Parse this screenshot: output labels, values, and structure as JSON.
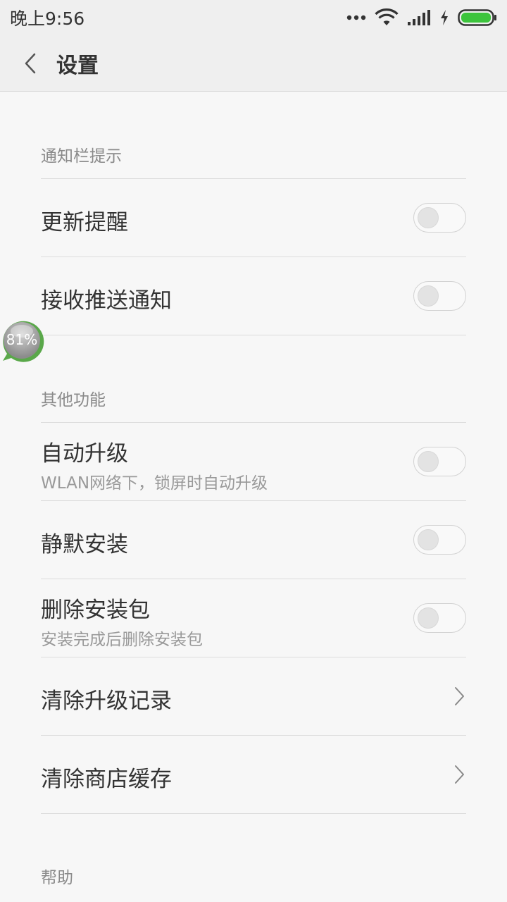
{
  "status_bar": {
    "time": "晚上9:56",
    "icons": [
      "more-dots-icon",
      "wifi-icon",
      "signal-icon",
      "charging-icon",
      "battery-icon"
    ],
    "battery_color": "#3cc43c"
  },
  "header": {
    "title": "设置",
    "back_icon": "chevron-left-icon"
  },
  "sections": [
    {
      "header": "通知栏提示",
      "items": [
        {
          "title": "更新提醒",
          "control": "toggle",
          "on": false
        },
        {
          "title": "接收推送通知",
          "control": "toggle",
          "on": false
        }
      ]
    },
    {
      "header": "其他功能",
      "items": [
        {
          "title": "自动升级",
          "subtitle": "WLAN网络下，锁屏时自动升级",
          "control": "toggle",
          "on": false
        },
        {
          "title": "静默安装",
          "control": "toggle",
          "on": false
        },
        {
          "title": "删除安装包",
          "subtitle": "安装完成后删除安装包",
          "control": "toggle",
          "on": false
        },
        {
          "title": "清除升级记录",
          "control": "chevron"
        },
        {
          "title": "清除商店缓存",
          "control": "chevron"
        }
      ]
    },
    {
      "header": "帮助",
      "items": []
    }
  ],
  "floating_bubble": {
    "text": "81%",
    "ring_color": "#5aa84a"
  }
}
